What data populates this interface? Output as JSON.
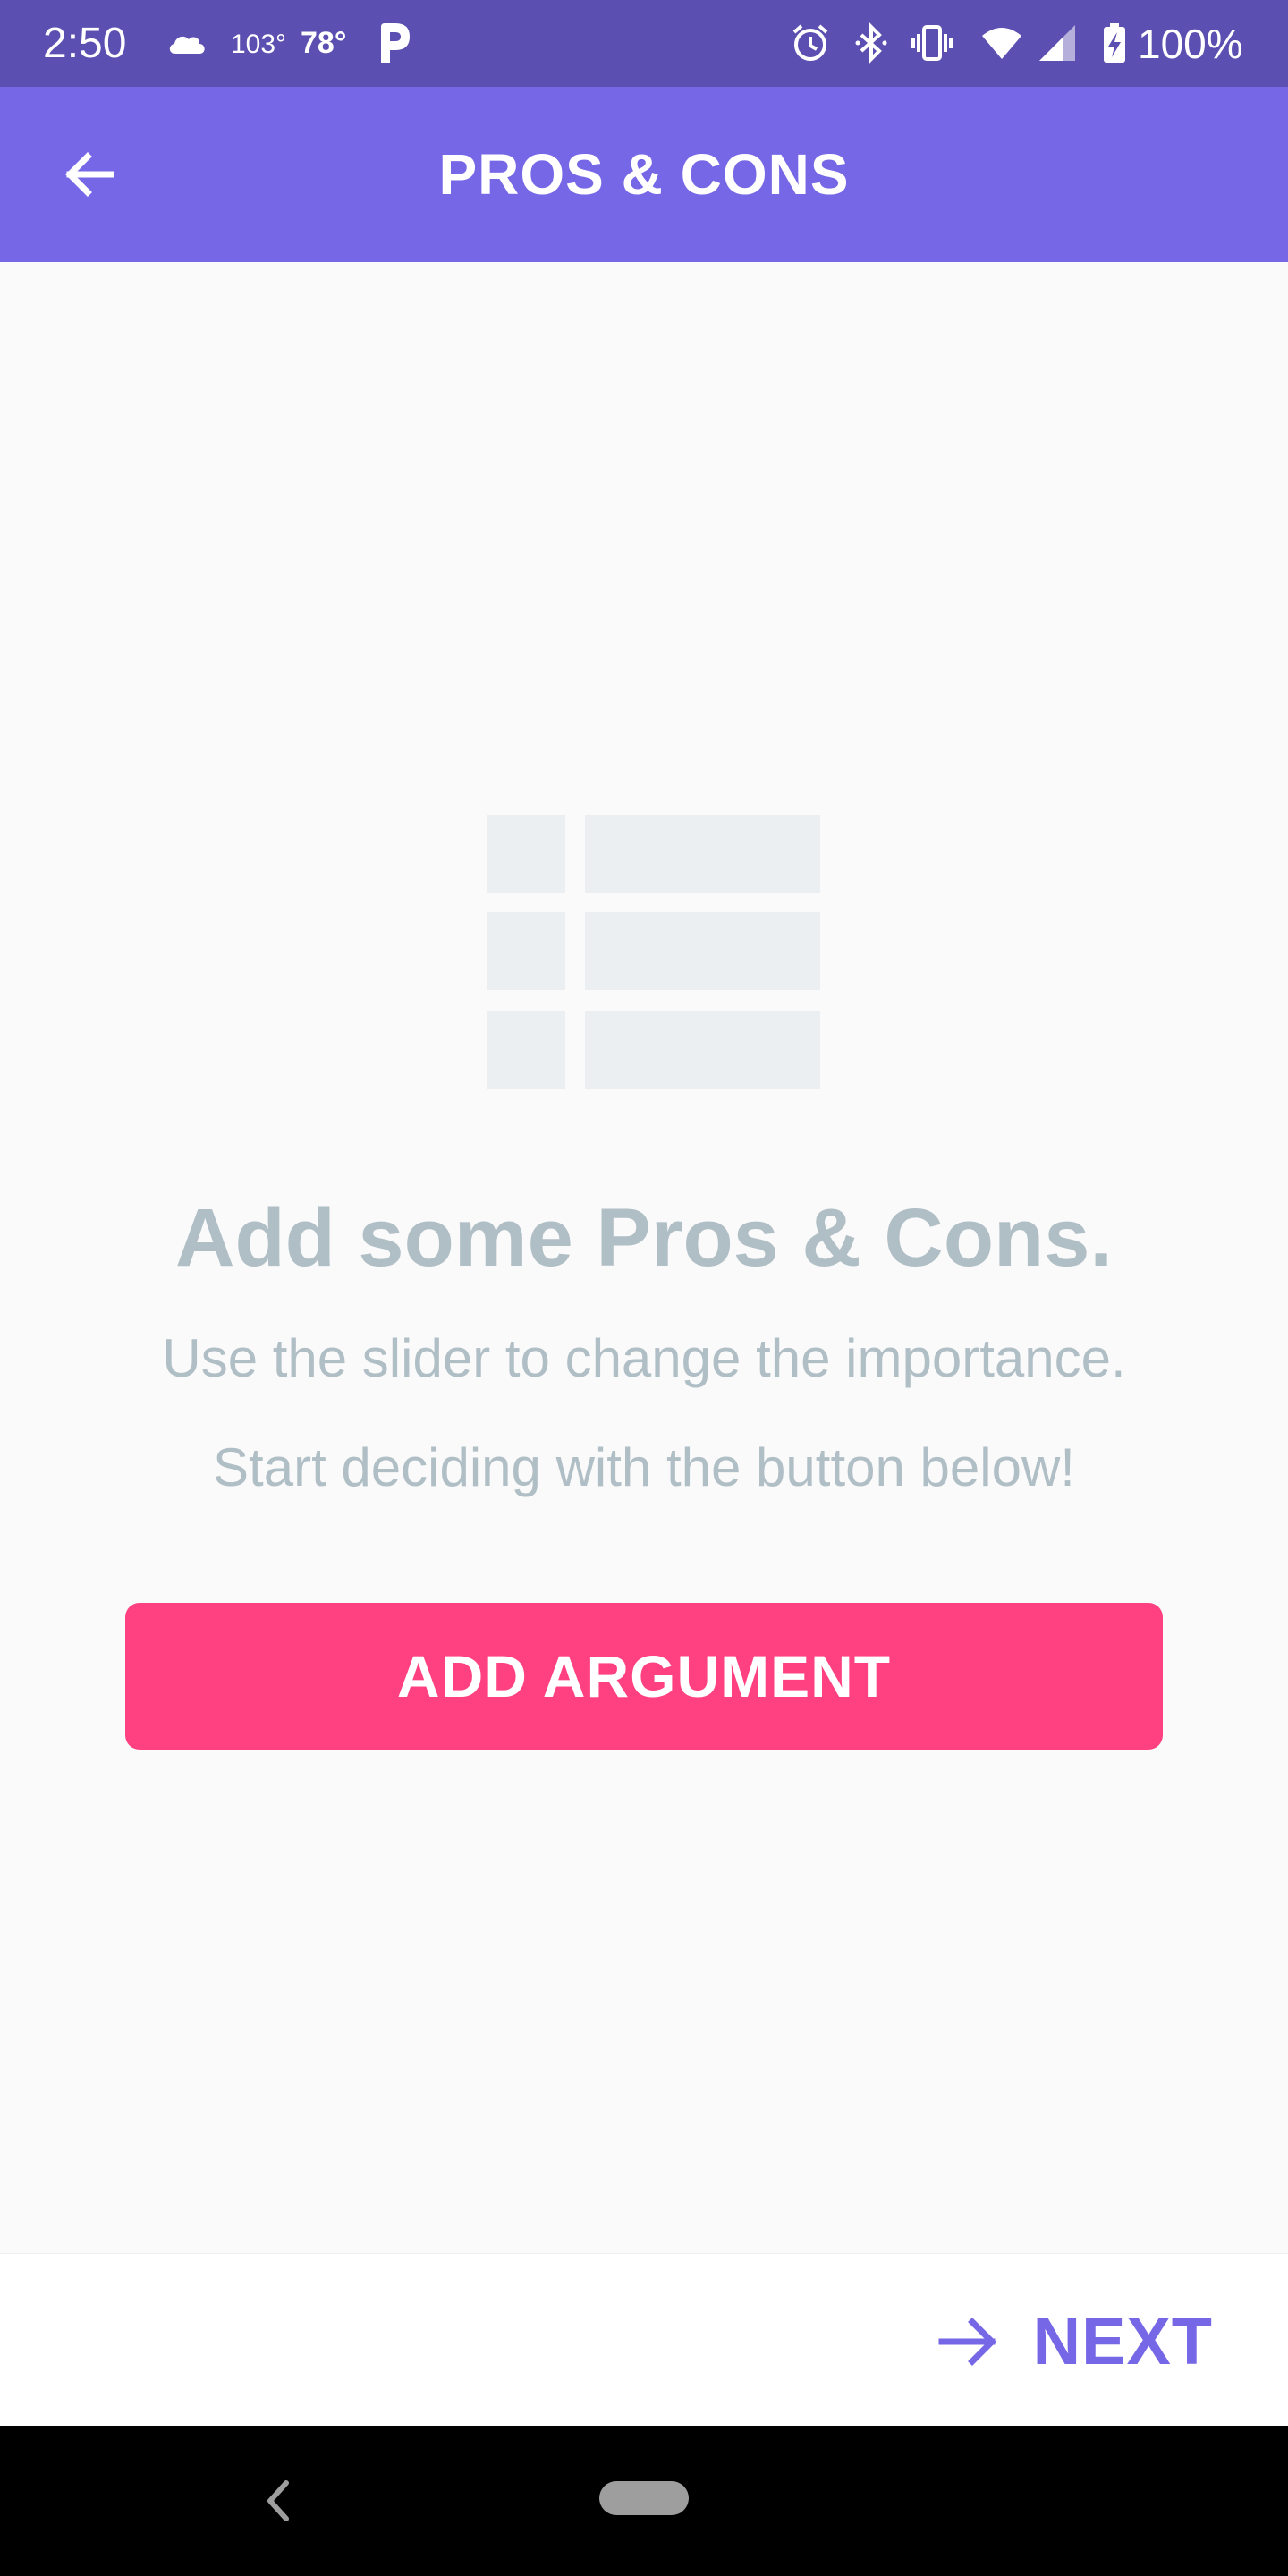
{
  "status_bar": {
    "time": "2:50",
    "temp_high": "103°",
    "temp_low": "78°",
    "battery": "100%",
    "icons": [
      "cloud-icon",
      "p-app-icon",
      "alarm-icon",
      "bluetooth-icon",
      "vibrate-icon",
      "wifi-icon",
      "cell-signal-icon",
      "battery-charging-icon"
    ]
  },
  "app_bar": {
    "title": "PROS & CONS",
    "back_icon": "arrow-left-icon"
  },
  "empty_state": {
    "illustration_icon": "table-list-icon",
    "title": "Add some Pros & Cons.",
    "line1": "Use the slider to change the importance.",
    "line2": "Start deciding with the button below!"
  },
  "actions": {
    "add_argument_label": "ADD ARGUMENT",
    "next_label": "NEXT",
    "next_icon": "arrow-right-icon"
  },
  "colors": {
    "status_bar": "#5b4fb1",
    "primary": "#7667e6",
    "accent": "#ff4081",
    "muted_text": "#b0bec5",
    "placeholder": "#eceff1"
  }
}
